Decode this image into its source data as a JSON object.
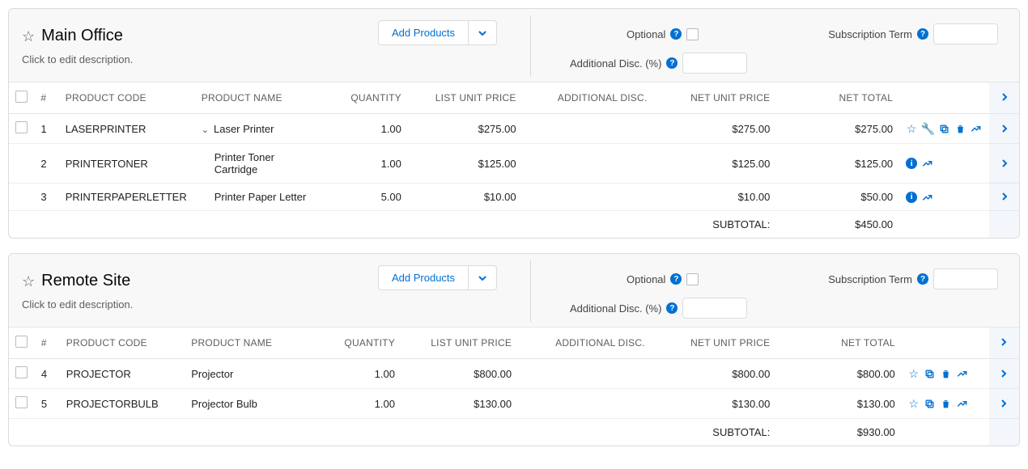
{
  "labels": {
    "add_products": "Add Products",
    "optional": "Optional",
    "subscription_term": "Subscription Term",
    "additional_disc_pct": "Additional Disc. (%)",
    "subtotal": "SUBTOTAL:",
    "desc_placeholder": "Click to edit description."
  },
  "columns": {
    "num": "#",
    "code": "PRODUCT CODE",
    "name": "PRODUCT NAME",
    "qty": "QUANTITY",
    "list": "LIST UNIT PRICE",
    "disc": "ADDITIONAL DISC.",
    "netunit": "NET UNIT PRICE",
    "nettot": "NET TOTAL"
  },
  "groups": [
    {
      "title": "Main Office",
      "subtotal": "$450.00",
      "rows": [
        {
          "num": "1",
          "code": "LASERPRINTER",
          "name": "Laser Printer",
          "qty": "1.00",
          "list": "$275.00",
          "disc": "",
          "netunit": "$275.00",
          "nettot": "$275.00",
          "parent": true,
          "checkable": true,
          "icons": [
            "star",
            "wrench",
            "copy",
            "trash",
            "trend"
          ]
        },
        {
          "num": "2",
          "code": "PRINTERTONER",
          "name": "Printer Toner Cartridge",
          "qty": "1.00",
          "list": "$125.00",
          "disc": "",
          "netunit": "$125.00",
          "nettot": "$125.00",
          "child": true,
          "icons": [
            "info",
            "trend"
          ]
        },
        {
          "num": "3",
          "code": "PRINTERPAPERLETTER",
          "name": "Printer Paper Letter",
          "qty": "5.00",
          "list": "$10.00",
          "disc": "",
          "netunit": "$10.00",
          "nettot": "$50.00",
          "child": true,
          "icons": [
            "info",
            "trend"
          ]
        }
      ]
    },
    {
      "title": "Remote Site",
      "subtotal": "$930.00",
      "rows": [
        {
          "num": "4",
          "code": "PROJECTOR",
          "name": "Projector",
          "qty": "1.00",
          "list": "$800.00",
          "disc": "",
          "netunit": "$800.00",
          "nettot": "$800.00",
          "checkable": true,
          "icons": [
            "star",
            "copy",
            "trash",
            "trend"
          ]
        },
        {
          "num": "5",
          "code": "PROJECTORBULB",
          "name": "Projector Bulb",
          "qty": "1.00",
          "list": "$130.00",
          "disc": "",
          "netunit": "$130.00",
          "nettot": "$130.00",
          "checkable": true,
          "icons": [
            "star",
            "copy",
            "trash",
            "trend"
          ]
        }
      ]
    }
  ]
}
